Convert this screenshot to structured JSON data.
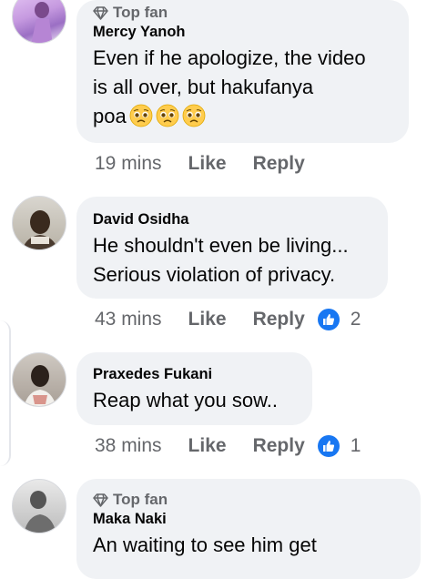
{
  "comments": [
    {
      "badge": "Top fan",
      "author": "Mercy  Yanoh",
      "lines": [
        "Even if he apologize, the video",
        "is all over, but hakufanya",
        "poa"
      ],
      "emoji": "pleading-face",
      "time": "19 mins",
      "like": "Like",
      "reply": "Reply"
    },
    {
      "author": "David Osidha",
      "lines": [
        "He shouldn't even be living...",
        "Serious violation of privacy."
      ],
      "time": "43 mins",
      "like": "Like",
      "reply": "Reply",
      "reactions": "2"
    },
    {
      "author": "Praxedes Fukani",
      "lines": [
        "Reap what you sow.."
      ],
      "time": "38 mins",
      "like": "Like",
      "reply": "Reply",
      "reactions": "1"
    },
    {
      "badge": "Top fan",
      "author": "Maka Naki",
      "lines": [
        "An waiting to see him get"
      ]
    }
  ],
  "colors": {
    "bubble": "#f0f2f5",
    "meta_text": "#65676b",
    "like_badge": "#1877f2"
  },
  "icons": {
    "badge": "diamond-icon",
    "reaction": "thumbs-up-icon",
    "emoji": "pleading-face-emoji"
  }
}
